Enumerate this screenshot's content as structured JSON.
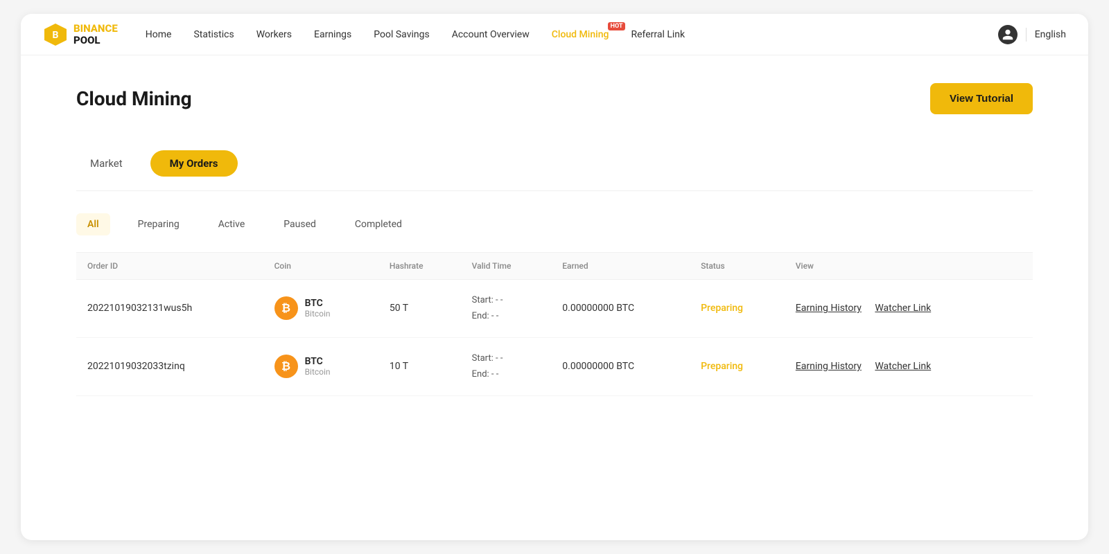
{
  "logo": {
    "line1": "BINANCE",
    "line2": "POOL"
  },
  "nav": {
    "links": [
      {
        "label": "Home",
        "id": "home",
        "active": false
      },
      {
        "label": "Statistics",
        "id": "statistics",
        "active": false
      },
      {
        "label": "Workers",
        "id": "workers",
        "active": false
      },
      {
        "label": "Earnings",
        "id": "earnings",
        "active": false
      },
      {
        "label": "Pool Savings",
        "id": "pool-savings",
        "active": false
      },
      {
        "label": "Account Overview",
        "id": "account-overview",
        "active": false
      },
      {
        "label": "Cloud Mining",
        "id": "cloud-mining",
        "active": true
      },
      {
        "label": "Referral Link",
        "id": "referral-link",
        "active": false
      }
    ],
    "hot_badge": "HOT",
    "language": "English"
  },
  "page": {
    "title": "Cloud Mining",
    "view_tutorial_label": "View Tutorial"
  },
  "tab_bar": {
    "market_label": "Market",
    "my_orders_label": "My Orders"
  },
  "status_filters": [
    {
      "label": "All",
      "id": "all",
      "active": true
    },
    {
      "label": "Preparing",
      "id": "preparing",
      "active": false
    },
    {
      "label": "Active",
      "id": "active",
      "active": false
    },
    {
      "label": "Paused",
      "id": "paused",
      "active": false
    },
    {
      "label": "Completed",
      "id": "completed",
      "active": false
    }
  ],
  "table": {
    "headers": [
      {
        "label": "Order ID",
        "id": "order-id"
      },
      {
        "label": "Coin",
        "id": "coin"
      },
      {
        "label": "Hashrate",
        "id": "hashrate"
      },
      {
        "label": "Valid Time",
        "id": "valid-time"
      },
      {
        "label": "Earned",
        "id": "earned"
      },
      {
        "label": "Status",
        "id": "status"
      },
      {
        "label": "View",
        "id": "view"
      }
    ],
    "rows": [
      {
        "order_id": "20221019032131wus5h",
        "coin_symbol": "BTC",
        "coin_name": "Bitcoin",
        "coin_icon": "₿",
        "hashrate": "50 T",
        "start_label": "Start: - -",
        "end_label": "End: - -",
        "earned": "0.00000000 BTC",
        "status": "Preparing",
        "earning_history_label": "Earning History",
        "watcher_link_label": "Watcher Link"
      },
      {
        "order_id": "20221019032033tzinq",
        "coin_symbol": "BTC",
        "coin_name": "Bitcoin",
        "coin_icon": "₿",
        "hashrate": "10 T",
        "start_label": "Start: - -",
        "end_label": "End: - -",
        "earned": "0.00000000 BTC",
        "status": "Preparing",
        "earning_history_label": "Earning History",
        "watcher_link_label": "Watcher Link"
      }
    ]
  }
}
